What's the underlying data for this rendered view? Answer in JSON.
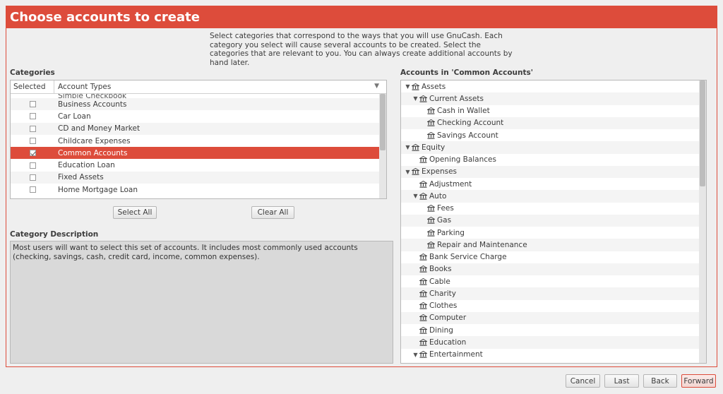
{
  "window": {
    "title": "Choose accounts to create"
  },
  "intro": {
    "text": "Select categories that correspond to the ways that you will use GnuCash. Each category you select will cause several accounts to be created. Select the categories that are relevant to you. You can always create additional accounts by hand later."
  },
  "categories": {
    "label": "Categories",
    "col_selected": "Selected",
    "col_account_types": "Account Types",
    "partial_item": "Simple Checkbook",
    "items": [
      {
        "name": "Business Accounts",
        "checked": false
      },
      {
        "name": "Car Loan",
        "checked": false
      },
      {
        "name": "CD and Money Market",
        "checked": false
      },
      {
        "name": "Childcare Expenses",
        "checked": false
      },
      {
        "name": "Common Accounts",
        "checked": true
      },
      {
        "name": "Education Loan",
        "checked": false
      },
      {
        "name": "Fixed Assets",
        "checked": false
      },
      {
        "name": "Home Mortgage Loan",
        "checked": false
      }
    ],
    "select_all": "Select All",
    "clear_all": "Clear All"
  },
  "description": {
    "label": "Category Description",
    "text": "Most users will want to select this set of accounts. It includes most commonly used accounts (checking, savings, cash, credit card, income, common expenses)."
  },
  "accounts": {
    "label": "Accounts in 'Common Accounts'",
    "rows": [
      {
        "name": "Assets",
        "level": 0,
        "expander": true
      },
      {
        "name": "Current Assets",
        "level": 1,
        "expander": true
      },
      {
        "name": "Cash in Wallet",
        "level": 2,
        "expander": false
      },
      {
        "name": "Checking Account",
        "level": 2,
        "expander": false
      },
      {
        "name": "Savings Account",
        "level": 2,
        "expander": false
      },
      {
        "name": "Equity",
        "level": 0,
        "expander": true
      },
      {
        "name": "Opening Balances",
        "level": 1,
        "expander": false
      },
      {
        "name": "Expenses",
        "level": 0,
        "expander": true
      },
      {
        "name": "Adjustment",
        "level": 1,
        "expander": false
      },
      {
        "name": "Auto",
        "level": 1,
        "expander": true
      },
      {
        "name": "Fees",
        "level": 2,
        "expander": false
      },
      {
        "name": "Gas",
        "level": 2,
        "expander": false
      },
      {
        "name": "Parking",
        "level": 2,
        "expander": false
      },
      {
        "name": "Repair and Maintenance",
        "level": 2,
        "expander": false
      },
      {
        "name": "Bank Service Charge",
        "level": 1,
        "expander": false
      },
      {
        "name": "Books",
        "level": 1,
        "expander": false
      },
      {
        "name": "Cable",
        "level": 1,
        "expander": false
      },
      {
        "name": "Charity",
        "level": 1,
        "expander": false
      },
      {
        "name": "Clothes",
        "level": 1,
        "expander": false
      },
      {
        "name": "Computer",
        "level": 1,
        "expander": false
      },
      {
        "name": "Dining",
        "level": 1,
        "expander": false
      },
      {
        "name": "Education",
        "level": 1,
        "expander": false
      },
      {
        "name": "Entertainment",
        "level": 1,
        "expander": true
      }
    ]
  },
  "footer": {
    "cancel": "Cancel",
    "last": "Last",
    "back": "Back",
    "forward": "Forward"
  },
  "colors": {
    "accent": "#dd4c3b"
  },
  "icons": {
    "expander": "triangle-down-icon",
    "account": "bank-icon"
  }
}
